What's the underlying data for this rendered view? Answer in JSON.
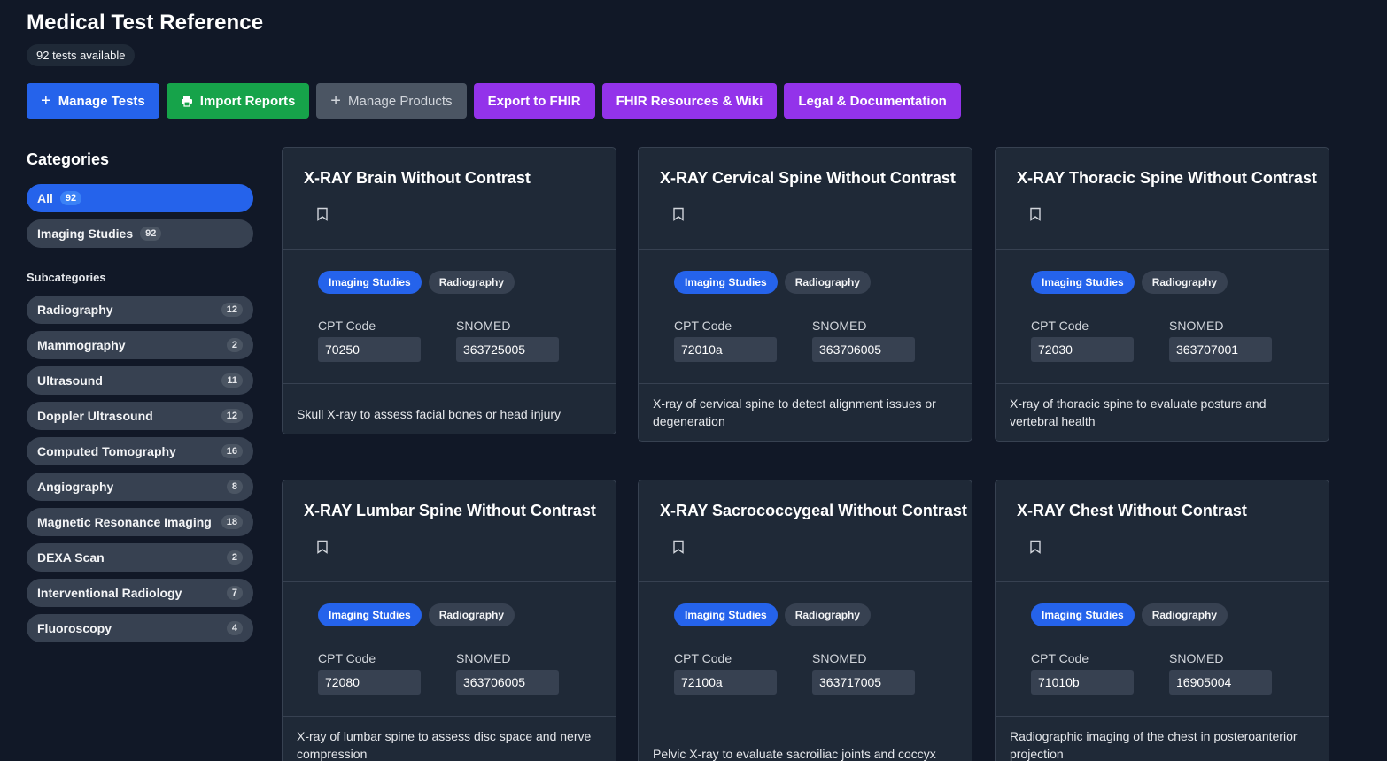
{
  "header": {
    "title": "Medical Test Reference",
    "count_label": "92 tests available"
  },
  "toolbar": {
    "manage_tests": "Manage Tests",
    "import_reports": "Import Reports",
    "manage_products": "Manage Products",
    "export_fhir": "Export to FHIR",
    "fhir_resources": "FHIR Resources & Wiki",
    "legal_docs": "Legal & Documentation"
  },
  "sidebar": {
    "categories_heading": "Categories",
    "categories": [
      {
        "label": "All",
        "count": "92"
      },
      {
        "label": "Imaging Studies",
        "count": "92"
      }
    ],
    "subcategories_heading": "Subcategories",
    "subcategories": [
      {
        "label": "Radiography",
        "count": "12"
      },
      {
        "label": "Mammography",
        "count": "2"
      },
      {
        "label": "Ultrasound",
        "count": "11"
      },
      {
        "label": "Doppler Ultrasound",
        "count": "12"
      },
      {
        "label": "Computed Tomography",
        "count": "16"
      },
      {
        "label": "Angiography",
        "count": "8"
      },
      {
        "label": "Magnetic Resonance Imaging",
        "count": "18"
      },
      {
        "label": "DEXA Scan",
        "count": "2"
      },
      {
        "label": "Interventional Radiology",
        "count": "7"
      },
      {
        "label": "Fluoroscopy",
        "count": "4"
      }
    ]
  },
  "cards": [
    {
      "title": "X-RAY Brain Without Contrast",
      "tag1": "Imaging Studies",
      "tag2": "Radiography",
      "cpt_label": "CPT Code",
      "cpt": "70250",
      "snomed_label": "SNOMED",
      "snomed": "363725005",
      "desc": "Skull X-ray to assess facial bones or head injury"
    },
    {
      "title": "X-RAY Cervical Spine Without Contrast",
      "tag1": "Imaging Studies",
      "tag2": "Radiography",
      "cpt_label": "CPT Code",
      "cpt": "72010a",
      "snomed_label": "SNOMED",
      "snomed": "363706005",
      "desc": "X-ray of cervical spine to detect alignment issues or degeneration"
    },
    {
      "title": "X-RAY Thoracic Spine Without Contrast",
      "tag1": "Imaging Studies",
      "tag2": "Radiography",
      "cpt_label": "CPT Code",
      "cpt": "72030",
      "snomed_label": "SNOMED",
      "snomed": "363707001",
      "desc": "X-ray of thoracic spine to evaluate posture and vertebral health"
    },
    {
      "title": "X-RAY Lumbar Spine Without Contrast",
      "tag1": "Imaging Studies",
      "tag2": "Radiography",
      "cpt_label": "CPT Code",
      "cpt": "72080",
      "snomed_label": "SNOMED",
      "snomed": "363706005",
      "desc": "X-ray of lumbar spine to assess disc space and nerve compression"
    },
    {
      "title": "X-RAY Sacrococcygeal Without Contrast",
      "tag1": "Imaging Studies",
      "tag2": "Radiography",
      "cpt_label": "CPT Code",
      "cpt": "72100a",
      "snomed_label": "SNOMED",
      "snomed": "363717005",
      "desc": "Pelvic X-ray to evaluate sacroiliac joints and coccyx"
    },
    {
      "title": "X-RAY Chest Without Contrast",
      "tag1": "Imaging Studies",
      "tag2": "Radiography",
      "cpt_label": "CPT Code",
      "cpt": "71010b",
      "snomed_label": "SNOMED",
      "snomed": "16905004",
      "desc": "Radiographic imaging of the chest in posteroanterior projection"
    }
  ]
}
